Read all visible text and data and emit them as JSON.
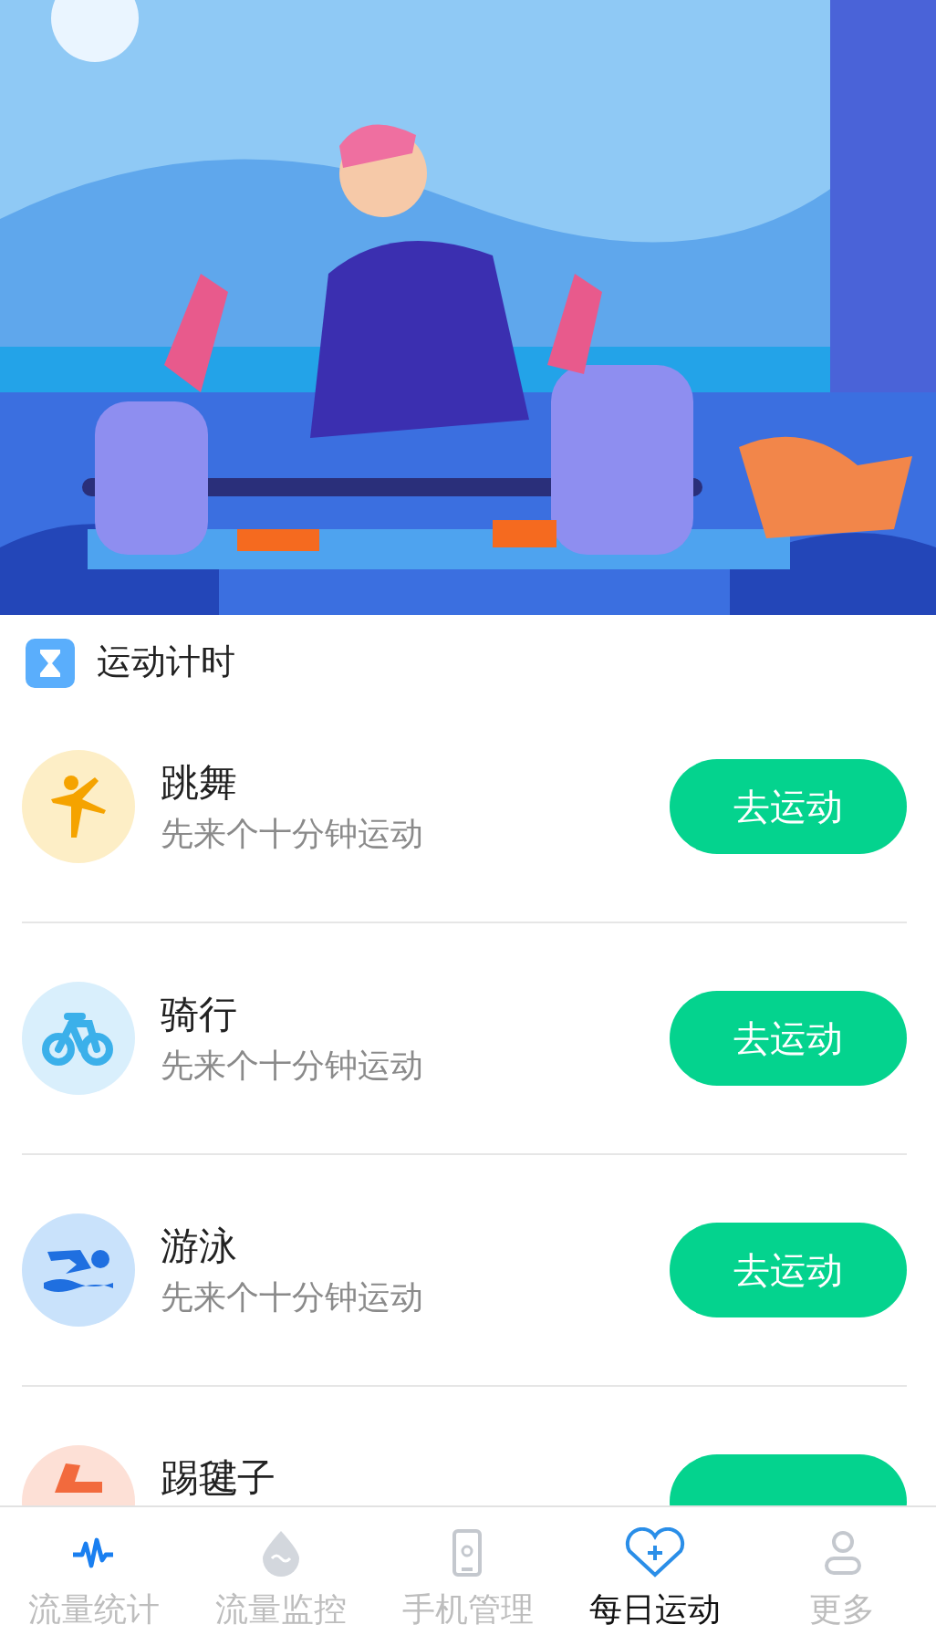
{
  "section": {
    "title": "运动计时"
  },
  "activities": [
    {
      "kind": "dance",
      "name": "跳舞",
      "subtitle": "先来个十分钟运动",
      "button": "去运动"
    },
    {
      "kind": "cycling",
      "name": "骑行",
      "subtitle": "先来个十分钟运动",
      "button": "去运动"
    },
    {
      "kind": "swimming",
      "name": "游泳",
      "subtitle": "先来个十分钟运动",
      "button": "去运动"
    },
    {
      "kind": "shuttlecock",
      "name": "踢毽子"
    }
  ],
  "tab_bar": [
    {
      "kind": "stats",
      "label": "流量统计",
      "selected": false
    },
    {
      "kind": "monitor",
      "label": "流量监控",
      "selected": false
    },
    {
      "kind": "phone",
      "label": "手机管理",
      "selected": false
    },
    {
      "kind": "exercise",
      "label": "每日运动",
      "selected": true
    },
    {
      "kind": "more",
      "label": "更多",
      "selected": false
    }
  ]
}
